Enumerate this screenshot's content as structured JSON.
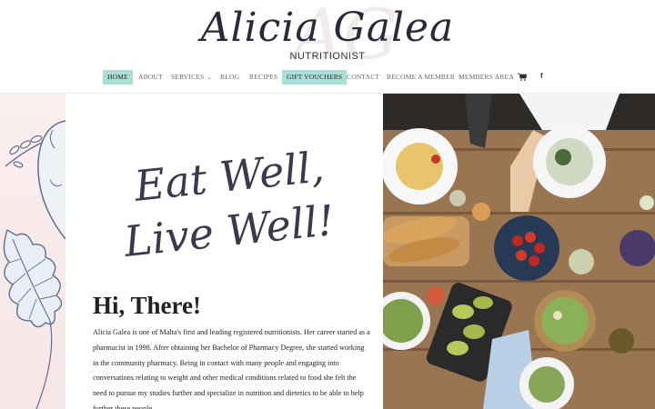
{
  "brand": {
    "name": "Alicia Galea",
    "subtitle": "NUTRITIONIST"
  },
  "nav": {
    "items": [
      {
        "label": "HOME",
        "active": true
      },
      {
        "label": "ABOUT"
      },
      {
        "label": "SERVICES",
        "has_dropdown": true
      },
      {
        "label": "BLOG"
      },
      {
        "label": "RECIPES"
      },
      {
        "label": "GIFT VOUCHERS",
        "highlighted": true
      },
      {
        "label": "CONTACT"
      },
      {
        "label": "BECOME A MEMBER"
      },
      {
        "label": "MEMBERS AREA"
      }
    ],
    "icons": {
      "cart": "cart-icon",
      "facebook": "facebook-icon",
      "facebook_glyph": "f"
    }
  },
  "hero": {
    "line1": "Eat Well,",
    "line2": "Live Well!"
  },
  "intro": {
    "heading": "Hi, There!",
    "paragraph": "Alicia Galea is one of Malta's first and leading registered nutritionists. Her career started as a pharmacist in 1998. After obtaining her Bachelor of Pharmacy Degree, she started working in the community pharmacy. Being in contact with many people and engaging into conversations relating to weight and other medical conditions related to food she felt the need to pursue my studies further and specialize in nutrition and dietetics to be able to help further these people"
  },
  "colors": {
    "accent": "#a8e0d8",
    "text_dark": "#222222",
    "script": "#3a3a4e",
    "deco_bg": "#f6e6e6"
  }
}
